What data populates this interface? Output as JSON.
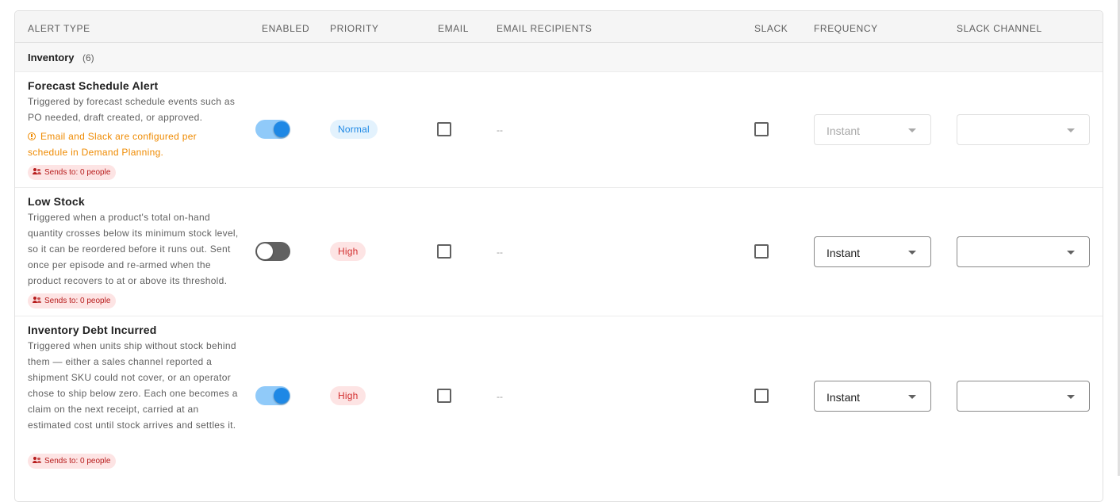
{
  "columns": {
    "alert_type": "ALERT TYPE",
    "enabled": "ENABLED",
    "priority": "PRIORITY",
    "email": "EMAIL",
    "email_recipients": "EMAIL RECIPIENTS",
    "slack": "SLACK",
    "frequency": "FREQUENCY",
    "slack_channel": "SLACK CHANNEL"
  },
  "group": {
    "name": "Inventory",
    "count": "(6)"
  },
  "rows": [
    {
      "title": "Forecast Schedule Alert",
      "description": "Triggered by forecast schedule events such as PO needed, draft created, or approved.",
      "warning": "Email and Slack are configured per schedule in Demand Planning.",
      "sends_to": "Sends to: 0 people",
      "enabled": true,
      "priority": "Normal",
      "email_checked": false,
      "email_recipients": "--",
      "slack_checked": false,
      "frequency": "Instant",
      "frequency_disabled": true,
      "slack_channel": ""
    },
    {
      "title": "Low Stock",
      "description": "Triggered when a product's total on-hand quantity crosses below its minimum stock level, so it can be reordered before it runs out. Sent once per episode and re-armed when the product recovers to at or above its threshold.",
      "warning": "",
      "sends_to": "Sends to: 0 people",
      "enabled": false,
      "priority": "High",
      "email_checked": false,
      "email_recipients": "--",
      "slack_checked": false,
      "frequency": "Instant",
      "frequency_disabled": false,
      "slack_channel": ""
    },
    {
      "title": "Inventory Debt Incurred",
      "description": "Triggered when units ship without stock behind them — either a sales channel reported a shipment SKU could not cover, or an operator chose to ship below zero. Each one becomes a claim on the next receipt, carried at an estimated cost until stock arrives and settles it.",
      "warning": "",
      "sends_to": "Sends to: 0 people",
      "enabled": true,
      "priority": "High",
      "email_checked": false,
      "email_recipients": "--",
      "slack_checked": false,
      "frequency": "Instant",
      "frequency_disabled": false,
      "slack_channel": ""
    }
  ]
}
